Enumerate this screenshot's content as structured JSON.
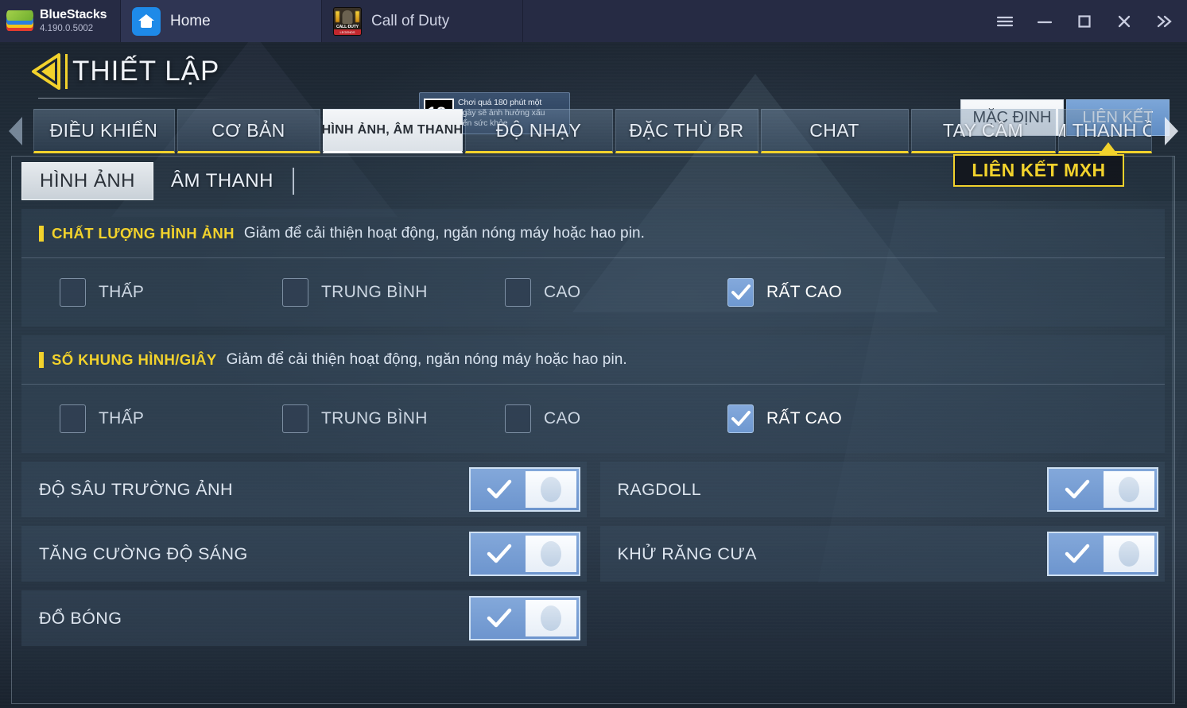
{
  "titlebar": {
    "brand_name": "BlueStacks",
    "brand_version": "4.190.0.5002",
    "tabs": [
      {
        "label": "Home",
        "icon": "home-icon"
      },
      {
        "label": "Call of Duty",
        "icon": "call-of-duty-icon"
      }
    ],
    "cod_icon_word": "CALL·DUTY",
    "cod_icon_sub": "LEGENDS",
    "controls": [
      {
        "name": "menu-button",
        "icon": "hamburger-icon"
      },
      {
        "name": "minimize-button",
        "icon": "minimize-icon"
      },
      {
        "name": "maximize-button",
        "icon": "maximize-icon"
      },
      {
        "name": "close-button",
        "icon": "close-icon"
      },
      {
        "name": "expand-button",
        "icon": "chevron-double-right-icon"
      }
    ]
  },
  "game_header": {
    "title": "THIẾT LẬP",
    "back_icon": "back-arrow-icon",
    "age_badge": {
      "rating": "18",
      "rating_suffix": "+",
      "line1": "Chơi quá 180 phút một",
      "line2": "ngày sẽ ảnh hưởng xấu",
      "line3": "đến sức khỏe"
    },
    "buttons": {
      "default_label": "MẶC ĐỊNH",
      "link_label": "LIÊN KẾT"
    }
  },
  "main_tabs": {
    "prev_icon": "chevron-left-icon",
    "next_icon": "chevron-right-icon",
    "items": [
      {
        "label": "ĐIỀU KHIỂN",
        "active": false
      },
      {
        "label": "CƠ BẢN",
        "active": false
      },
      {
        "label": "HÌNH ẢNH, ÂM THANH",
        "active": true
      },
      {
        "label": "ĐỘ NHẠY",
        "active": false
      },
      {
        "label": "ĐẶC THÙ BR",
        "active": false
      },
      {
        "label": "CHAT",
        "active": false
      },
      {
        "label": "TAY CẦM",
        "active": false
      },
      {
        "label": "ÂM THANH ỒN",
        "active": false
      }
    ]
  },
  "tooltip": {
    "label": "LIÊN KẾT MXH"
  },
  "sub_tabs": [
    {
      "label": "HÌNH ẢNH",
      "active": true
    },
    {
      "label": "ÂM THANH",
      "active": false
    }
  ],
  "groups": [
    {
      "title": "CHẤT LƯỢNG HÌNH ẢNH",
      "description": "Giảm để cải thiện hoạt động, ngăn nóng máy hoặc hao pin.",
      "options": [
        {
          "label": "THẤP",
          "checked": false
        },
        {
          "label": "TRUNG BÌNH",
          "checked": false
        },
        {
          "label": "CAO",
          "checked": false
        },
        {
          "label": "RẤT CAO",
          "checked": true
        }
      ]
    },
    {
      "title": "SỐ KHUNG HÌNH/GIÂY",
      "description": "Giảm để cải thiện hoạt động, ngăn nóng máy hoặc hao pin.",
      "options": [
        {
          "label": "THẤP",
          "checked": false
        },
        {
          "label": "TRUNG BÌNH",
          "checked": false
        },
        {
          "label": "CAO",
          "checked": false
        },
        {
          "label": "RẤT CAO",
          "checked": true
        }
      ]
    }
  ],
  "toggles": {
    "left": [
      {
        "label": "ĐỘ SÂU TRƯỜNG ẢNH",
        "on": true
      },
      {
        "label": "TĂNG CƯỜNG ĐỘ SÁNG",
        "on": true
      },
      {
        "label": "ĐỔ BÓNG",
        "on": true
      }
    ],
    "right": [
      {
        "label": "RAGDOLL",
        "on": true
      },
      {
        "label": "KHỬ RĂNG CƯA",
        "on": true
      }
    ]
  },
  "colors": {
    "accent_yellow": "#f2d22c",
    "accent_blue": "#6e98d0",
    "titlebar_bg": "#262b44"
  }
}
